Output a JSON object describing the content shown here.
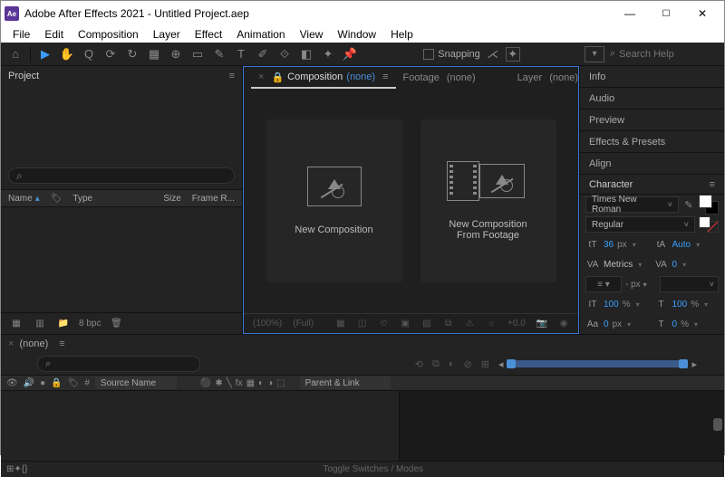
{
  "titlebar": {
    "icon": "Ae",
    "title": "Adobe After Effects 2021 - Untitled Project.aep"
  },
  "menu": {
    "items": [
      "File",
      "Edit",
      "Composition",
      "Layer",
      "Effect",
      "Animation",
      "View",
      "Window",
      "Help"
    ]
  },
  "toolbar": {
    "snapping_label": "Snapping",
    "search_placeholder": "Search Help"
  },
  "project_panel": {
    "tab": "Project",
    "cols": {
      "name": "Name",
      "type": "Type",
      "size": "Size",
      "frame": "Frame R..."
    },
    "footer_bpc": "8 bpc"
  },
  "center": {
    "tabs": {
      "comp_label": "Composition",
      "none": "(none)",
      "footage_label": "Footage",
      "layer_label": "Layer"
    },
    "card_new_comp": "New Composition",
    "card_from_footage_l1": "New Composition",
    "card_from_footage_l2": "From Footage",
    "footer": {
      "zoom": "(100%)",
      "res": "(Full)",
      "exp": "+0.0"
    }
  },
  "right_panels": {
    "info": "Info",
    "audio": "Audio",
    "preview": "Preview",
    "effects": "Effects & Presets",
    "align": "Align",
    "character": {
      "title": "Character",
      "font": "Times New Roman",
      "style": "Regular",
      "size_label": "tT",
      "size_val": "36",
      "size_unit": "px",
      "leading_label": "tA",
      "leading_val": "Auto",
      "kerning_label": "VA",
      "kerning_val": "Metrics",
      "tracking_label": "VA",
      "tracking_val": "0",
      "dash": "- px",
      "hscale_label": "IT",
      "hscale_val": "100",
      "hscale_unit": "%",
      "vscale_label": "T",
      "vscale_val": "100",
      "vscale_unit": "%",
      "baseline_label": "Aa",
      "baseline_val": "0",
      "baseline_unit": "px",
      "tsume_label": "T",
      "tsume_val": "0",
      "tsume_unit": "%"
    }
  },
  "timeline": {
    "tab_none": "(none)",
    "col_num": "#",
    "col_source": "Source Name",
    "col_parent": "Parent & Link",
    "toggle": "Toggle Switches / Modes"
  }
}
